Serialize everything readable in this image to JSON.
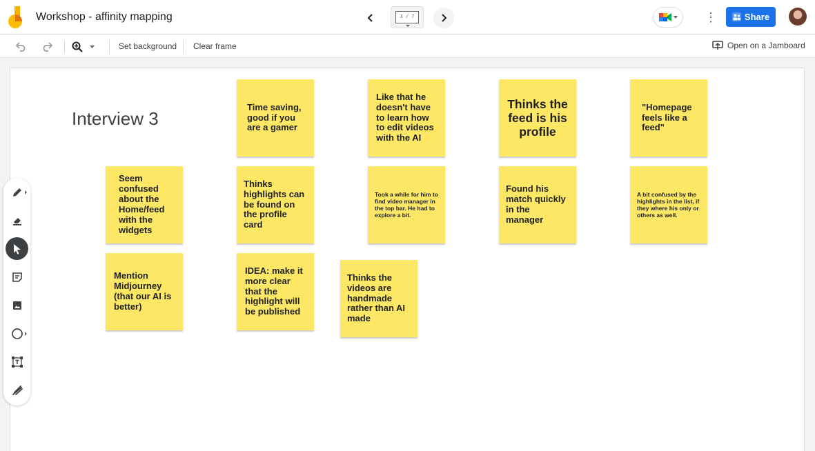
{
  "app": {
    "title": "Workshop - affinity mapping",
    "frame_indicator": "3 / 7",
    "share_label": "Share",
    "brand_color": "#f4b400",
    "accent_color": "#1a73e8"
  },
  "toolbar": {
    "undo_icon": "undo-icon",
    "redo_icon": "redo-icon",
    "zoom_icon": "zoom-icon",
    "set_background": "Set background",
    "clear_frame": "Clear frame",
    "open_jamboard": "Open on a Jamboard"
  },
  "board": {
    "title": "Interview 3",
    "note_color": "#fde765",
    "notes": [
      "Time saving, good if you are a gamer",
      "Like that he doesn't have to learn how to edit videos with the AI",
      "Thinks the feed is his profile",
      "\"Homepage feels like a feed\"",
      "Seem confused about the Home/feed with the widgets",
      "Thinks highlights can be found on the profile card",
      "Took a while for him to find video manager in the top bar. He had to explore a bit.",
      "Found his match quickly in the manager",
      "A bit confused by the highlights in the list, if they where his only or others as well.",
      "Mention Midjourney (that our AI is better)",
      "IDEA: make it more clear that the highlight will be published",
      "Thinks the videos are handmade rather than AI made"
    ]
  },
  "tools": [
    "pen-icon",
    "eraser-icon",
    "select-icon",
    "sticky-note-icon",
    "image-icon",
    "circle-icon",
    "text-box-icon",
    "laser-icon"
  ]
}
